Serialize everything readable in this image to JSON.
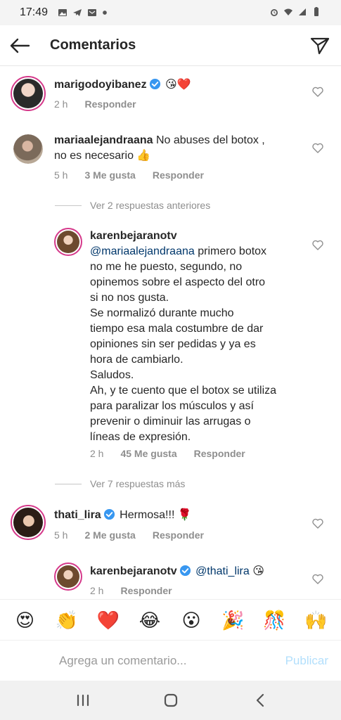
{
  "status": {
    "time": "17:49",
    "left_icons": [
      "image-icon",
      "telegram-icon",
      "mail-icon",
      "dot-icon"
    ],
    "right_icons": [
      "alarm-icon",
      "wifi-icon",
      "signal-icon",
      "battery-icon"
    ]
  },
  "header": {
    "title": "Comentarios"
  },
  "comments": [
    {
      "username": "marigodoyibanez",
      "text": "😘❤️",
      "time": "2 h",
      "reply_label": "Responder"
    },
    {
      "username": "mariaalejandraana",
      "text_line1": "No abuses del botox ,",
      "text_line2": "no es necesario 👍",
      "time": "5 h",
      "likes": "3 Me gusta",
      "reply_label": "Responder"
    },
    {
      "username": "karenbejaranotv",
      "mention": "@mariaalejandraana",
      "lines": [
        "primero botox",
        "no me he puesto, segundo, no",
        "opinemos sobre el aspecto del otro",
        "si no nos gusta.",
        "Se normalizó durante mucho",
        "tiempo esa mala costumbre de dar",
        "opiniones sin ser pedidas y ya es",
        "hora de cambiarlo.",
        "Saludos.",
        "Ah, y te cuento que el botox se utiliza",
        "para paralizar los músculos y así",
        "prevenir o diminuir las arrugas o",
        "líneas de expresión."
      ],
      "time": "2 h",
      "likes": "45 Me gusta",
      "reply_label": "Responder"
    },
    {
      "username": "thati_lira",
      "text": "Hermosa!!! 🌹",
      "time": "5 h",
      "likes": "2 Me gusta",
      "reply_label": "Responder"
    },
    {
      "username": "karenbejaranotv",
      "mention": "@thati_lira",
      "text": "😘",
      "time": "2 h",
      "reply_label": "Responder"
    }
  ],
  "replies_toggles": [
    "Ver 2 respuestas anteriores",
    "Ver 7 respuestas más"
  ],
  "emoji_bar": [
    "😍",
    "👏",
    "❤️",
    "😂",
    "😮",
    "🎉",
    "🎊",
    "🙌"
  ],
  "composer": {
    "placeholder": "Agrega un comentario...",
    "publish_label": "Publicar"
  },
  "colors": {
    "verified": "#3897f0",
    "meta": "#8e8e8e",
    "mention": "#00376b",
    "publish_disabled": "#b2dffc",
    "story_ring": "#d5398a"
  }
}
